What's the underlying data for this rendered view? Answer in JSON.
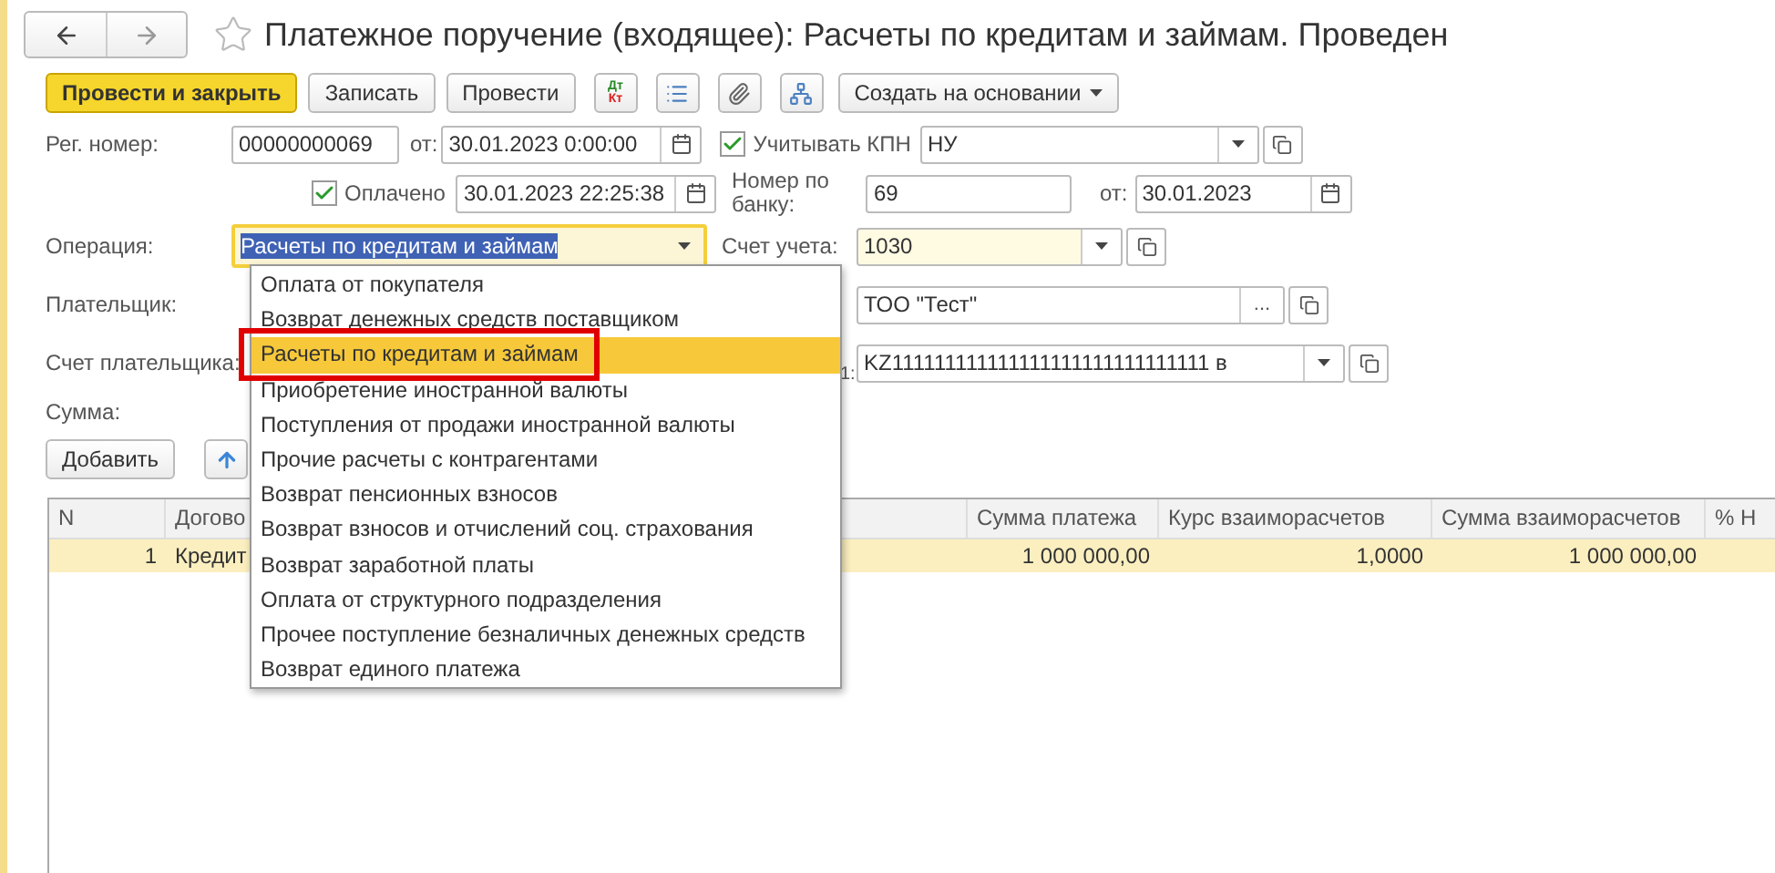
{
  "title": "Платежное поручение (входящее): Расчеты по кредитам и займам. Проведен",
  "toolbar": {
    "buttons": [
      {
        "label": "Провести и закрыть",
        "kind": "primary"
      },
      {
        "label": "Записать",
        "kind": "plain"
      },
      {
        "label": "Провести",
        "kind": "plain"
      }
    ],
    "dt_kt": {
      "top": "Дт",
      "bottom": "Кт"
    },
    "create_button": "Создать на основании"
  },
  "reg_number": {
    "label": "Рег. номер:",
    "value": "00000000069",
    "date_label": "от:",
    "date": "30.01.2023  0:00:00"
  },
  "kpn": {
    "label": "Учитывать КПН",
    "checked": true,
    "value": "НУ"
  },
  "paid": {
    "label": "Оплачено",
    "checked": true,
    "date": "30.01.2023 22:25:38"
  },
  "bank_number": {
    "label": "Номер по банку:",
    "value": "69",
    "date_label": "от:",
    "date": "30.01.2023"
  },
  "operation": {
    "label": "Операция:",
    "value": "Расчеты по кредитам и займам",
    "text_selected": true
  },
  "account": {
    "label": "Счет учета:",
    "value": "1030"
  },
  "payer": {
    "label": "Плательщик:",
    "counterparty": "ТОО \"Тест\"",
    "more": "..."
  },
  "payer_account": {
    "label": "Счет плательщика:",
    "recipient_label": "1:",
    "recipient_account": "KZ111111111111111111111111111111 в"
  },
  "amount": {
    "label": "Сумма:"
  },
  "table_toolbar": {
    "add": "Добавить"
  },
  "table": {
    "columns": [
      {
        "label": "N"
      },
      {
        "label": "Догово"
      },
      {
        "label": "Сумма платежа"
      },
      {
        "label": "Курс взаиморасчетов"
      },
      {
        "label": "Сумма взаиморасчетов"
      },
      {
        "label": "% Н"
      }
    ],
    "rows": [
      {
        "selected": true,
        "cells": [
          "1",
          "Кредит",
          "1 000 000,00",
          "1,0000",
          "1 000 000,00"
        ]
      }
    ]
  },
  "dropdown": {
    "items": [
      {
        "label": "Оплата от покупателя",
        "selected": false,
        "outlined": false
      },
      {
        "label": "Возврат денежных средств поставщиком",
        "selected": false,
        "outlined": false
      },
      {
        "label": "Расчеты по кредитам и займам",
        "selected": true,
        "outlined": true
      },
      {
        "label": "Приобретение иностранной валюты",
        "selected": false,
        "outlined": false
      },
      {
        "label": "Поступления от продажи иностранной валюты",
        "selected": false,
        "outlined": false
      },
      {
        "label": "Прочие расчеты с контрагентами",
        "selected": false,
        "outlined": false
      },
      {
        "label": "Возврат пенсионных взносов",
        "selected": false,
        "outlined": false
      },
      {
        "label": "Возврат взносов и отчислений соц. страхования",
        "selected": false,
        "outlined": false
      },
      {
        "label": "Возврат заработной платы",
        "selected": false,
        "outlined": false
      },
      {
        "label": "Оплата от структурного подразделения",
        "selected": false,
        "outlined": false
      },
      {
        "label": "Прочее поступление безналичных денежных средств",
        "selected": false,
        "outlined": false
      },
      {
        "label": "Возврат единого платежа",
        "selected": false,
        "outlined": false
      }
    ]
  }
}
